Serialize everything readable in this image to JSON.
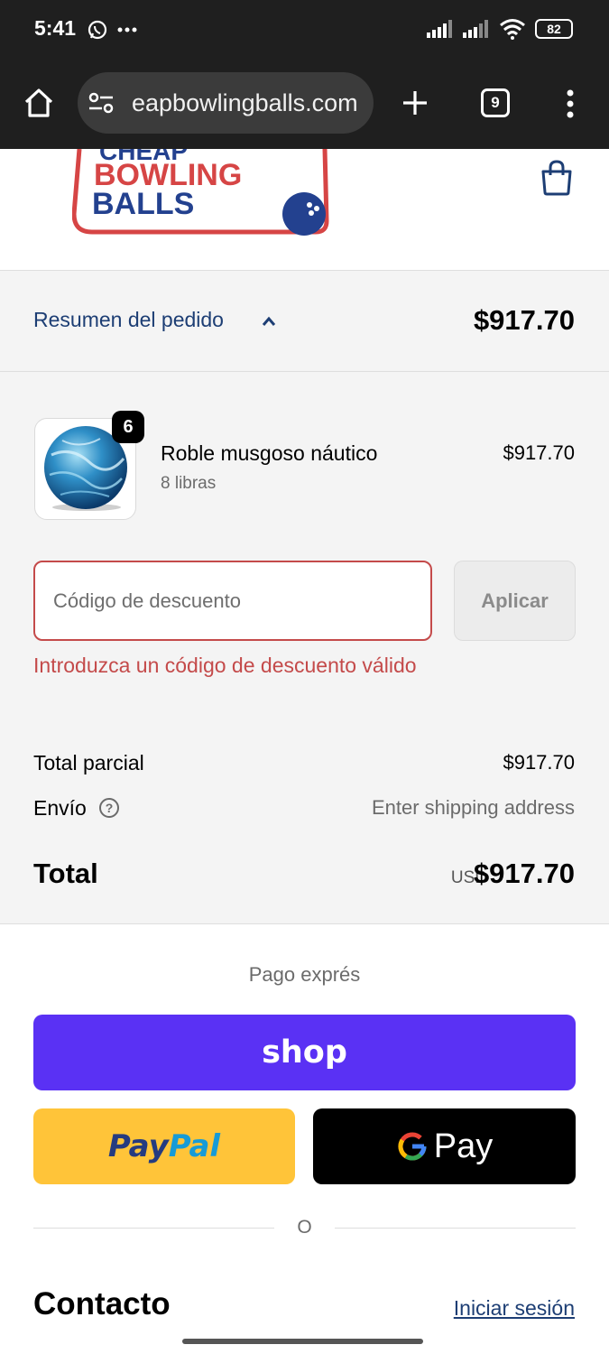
{
  "status_bar": {
    "time": "5:41",
    "battery": "82"
  },
  "browser": {
    "url": "eapbowlingballs.com",
    "tab_count": "9"
  },
  "site": {
    "logo_line1": "CHEAP",
    "logo_line2": "BOWLING",
    "logo_line3": "BALLS"
  },
  "summary": {
    "label": "Resumen del pedido",
    "total": "$917.70"
  },
  "product": {
    "quantity": "6",
    "name": "Roble musgoso náutico",
    "variant": "8 libras",
    "price": "$917.70"
  },
  "discount": {
    "placeholder": "Código de descuento",
    "apply_label": "Aplicar",
    "error": "Introduzca un código de descuento válido"
  },
  "totals": {
    "subtotal_label": "Total parcial",
    "subtotal_value": "$917.70",
    "shipping_label": "Envío",
    "shipping_value": "Enter shipping address",
    "total_label": "Total",
    "currency": "USD",
    "total_value": "$917.70"
  },
  "express": {
    "title": "Pago exprés",
    "shop_label": "shop",
    "paypal_a": "Pay",
    "paypal_b": "Pal",
    "gpay_label": "Pay",
    "or_label": "O"
  },
  "contact": {
    "title": "Contacto",
    "login_label": "Iniciar sesión"
  },
  "colors": {
    "shop_purple": "#5a31f4",
    "paypal_yellow": "#ffc439",
    "error_red": "#c44a4a",
    "link_blue": "#1d3e74"
  }
}
